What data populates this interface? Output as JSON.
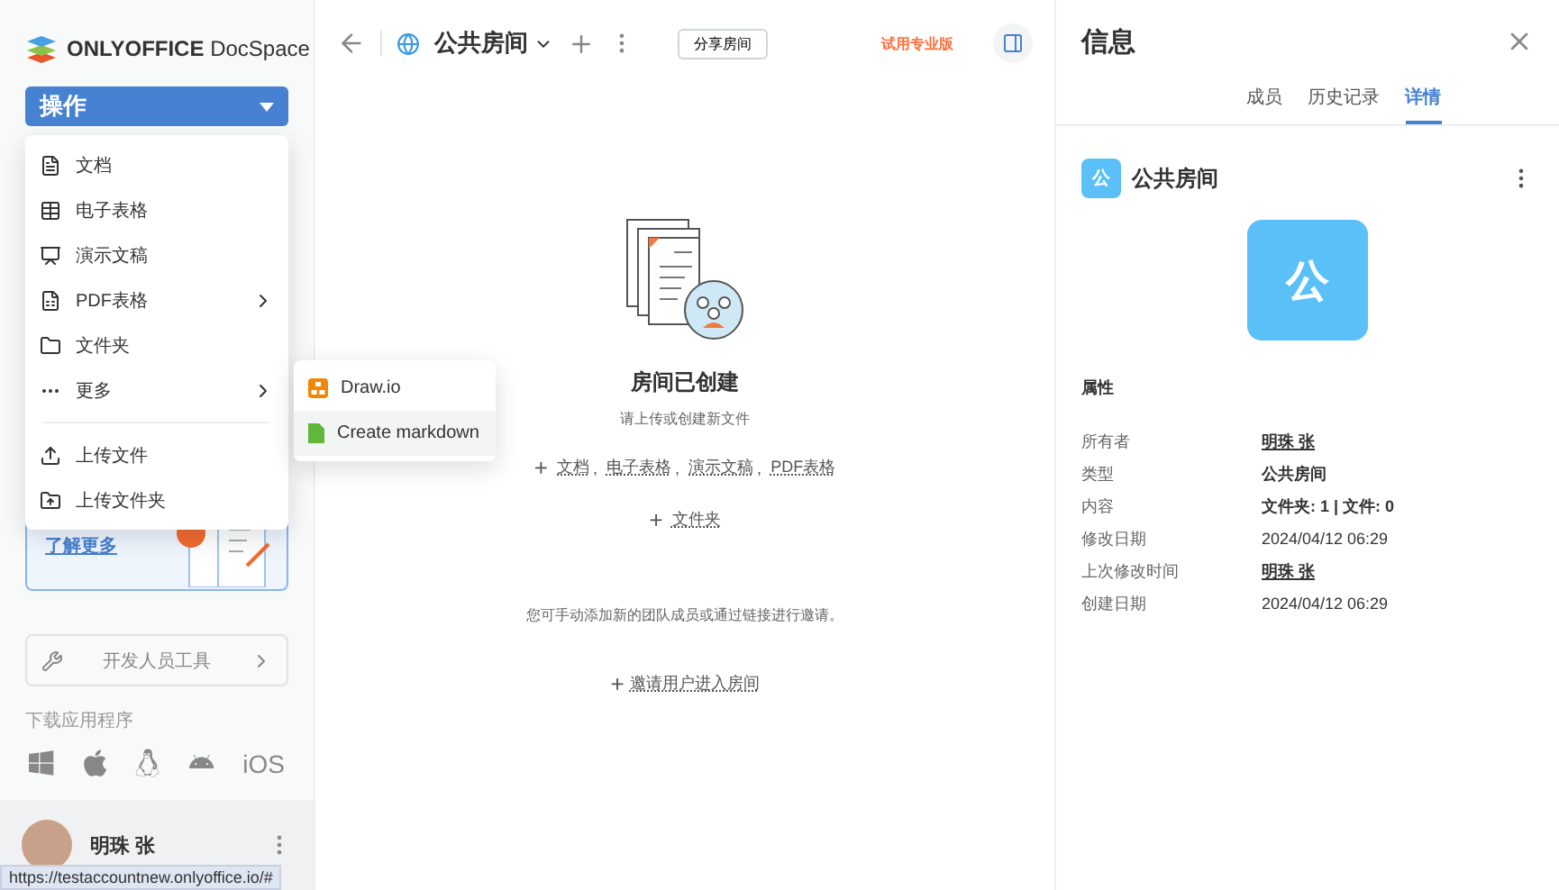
{
  "brand": {
    "name": "ONLYOFFICE",
    "product": "DocSpace"
  },
  "sidebar": {
    "action_button": "操作",
    "menu": [
      {
        "kind": "item",
        "label": "文档",
        "has_submenu": false
      },
      {
        "kind": "item",
        "label": "电子表格",
        "has_submenu": false
      },
      {
        "kind": "item",
        "label": "演示文稿",
        "has_submenu": false
      },
      {
        "kind": "item",
        "label": "PDF表格",
        "has_submenu": true
      },
      {
        "kind": "item",
        "label": "文件夹",
        "has_submenu": false
      },
      {
        "kind": "item",
        "label": "更多",
        "has_submenu": true
      },
      {
        "kind": "divider"
      },
      {
        "kind": "item",
        "label": "上传文件",
        "has_submenu": false
      },
      {
        "kind": "item",
        "label": "上传文件夹",
        "has_submenu": false
      }
    ],
    "submenu": [
      {
        "label": "Draw.io",
        "selected": false
      },
      {
        "label": "Create markdown",
        "selected": true
      }
    ],
    "promo": {
      "link": "了解更多"
    },
    "dev_tools": "开发人员工具",
    "download_label": "下载应用程序",
    "ios_label": "iOS",
    "user": {
      "name": "明珠 张"
    }
  },
  "status_url": "https://testaccountnew.onlyoffice.io/#",
  "header": {
    "title": "公共房间",
    "share_button": "分享房间",
    "trial": "试用专业版"
  },
  "empty": {
    "title": "房间已创建",
    "subtitle": "请上传或创建新文件",
    "plus": "+",
    "links": [
      "文档",
      "电子表格",
      "演示文稿",
      "PDF表格"
    ],
    "separator": ",",
    "folder_link": "文件夹",
    "invite_note": "您可手动添加新的团队成员或通过链接进行邀请。",
    "invite_link": "邀请用户进入房间"
  },
  "info": {
    "title": "信息",
    "tabs": [
      {
        "label": "成员",
        "selected": false
      },
      {
        "label": "历史记录",
        "selected": false
      },
      {
        "label": "详情",
        "selected": true
      }
    ],
    "room_name": "公共房间",
    "room_letter_small": "公",
    "room_letter_large": "公",
    "properties_title": "属性",
    "properties": [
      {
        "label": "所有者",
        "value": "明珠 张",
        "kind": "link"
      },
      {
        "label": "类型",
        "value": "公共房间",
        "kind": "bold"
      },
      {
        "label": "内容",
        "value": "文件夹: 1 | 文件: 0",
        "kind": "bold"
      },
      {
        "label": "修改日期",
        "value": "2024/04/12 06:29",
        "kind": "text"
      },
      {
        "label": "上次修改时间",
        "value": "明珠 张",
        "kind": "link"
      },
      {
        "label": "创建日期",
        "value": "2024/04/12 06:29",
        "kind": "text"
      }
    ]
  }
}
